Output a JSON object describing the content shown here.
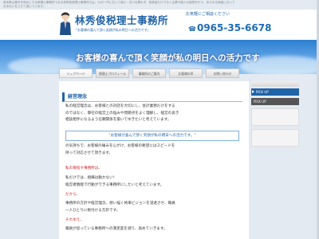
{
  "header": {
    "topnote": "熊本県山鹿市を拠点とする税理士事務所である林秀俊税理士事務所では、九州一円において個人・法人を問わず、経営者だけでなく企業や個人の経営を行う、あらゆる局面においてお手伝いをさせて頂いています。",
    "title": "林秀俊税理士事務所",
    "subtitle": "「お客様の喜んで頂く笑顔が私の明日への活力です」",
    "contact_label": "お気軽にご相談ください",
    "phone_prefix": "☎",
    "phone": "0965-35-6678"
  },
  "hero": {
    "text": "お客様の喜んで頂く笑顔が私の明日への活力です"
  },
  "nav": {
    "items": [
      {
        "label": "トップページ"
      },
      {
        "label": "税理士プロフィール"
      },
      {
        "label": "事務所のご案内"
      },
      {
        "label": "お客様の声"
      },
      {
        "label": "お問い合わせ"
      }
    ]
  },
  "sidebar": {
    "blue_label": "PICK UP",
    "dark_label": "PICK UP"
  },
  "main": {
    "heading": "経営理念",
    "para1_line1": "私の経営理念は、お客様との対話を大切にし、会計業務だけをする",
    "para1_line2": "のではなく、御社の経営上の悩みや問題点をよく理解し、経営の良き",
    "para1_line3": "相談相手になるよう信頼関係を築いてゆきたいと考えています。",
    "quote": "\"お客様が喜んで頂く笑顔が私の明日への活力です。\"",
    "para2_line1": "の気持ちで、お客様の痛みを心がけ、お客様の要望にはスピードを",
    "para2_line2": "持って対応させて頂きます。",
    "red1": "私の目指す事務所は、",
    "para3_line1": "私だけでは、組織は動かない！",
    "para3_line2": "経営者俄能で行動ができる事務所にしたいと考えています。",
    "red2": "だから、",
    "para4_line1": "事務所の方針や経営理念、想い描く将来ビジョンを浸透させ、職員",
    "para4_line2": "一人ひとりに根付ける方針です。",
    "red3": "それゆえ、",
    "para5_line1": "職員が思っている事務所への満足度を測り、高めていきます。"
  }
}
